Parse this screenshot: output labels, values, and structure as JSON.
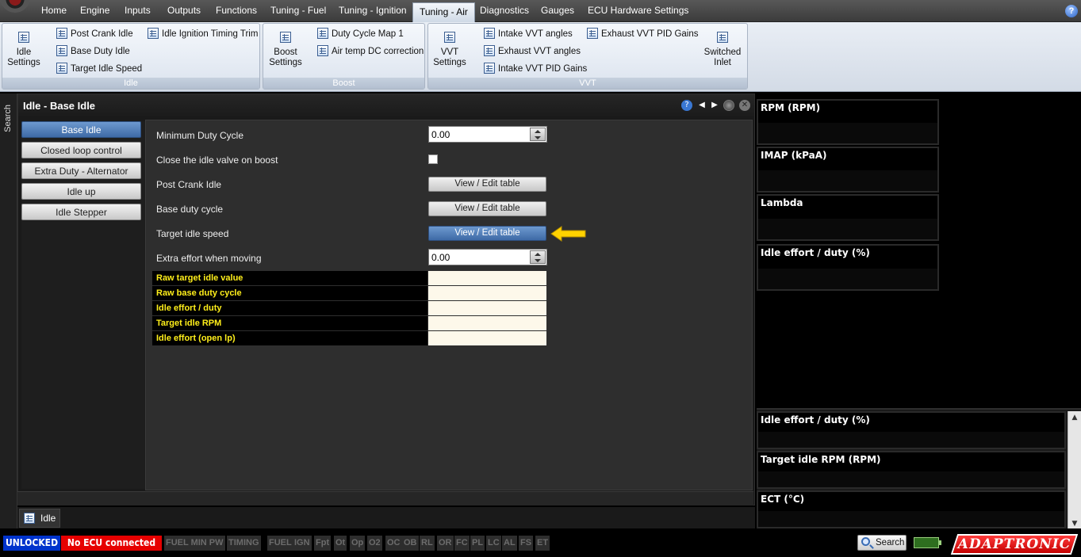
{
  "menubar": {
    "tabs": [
      "Home",
      "Engine",
      "Inputs",
      "Outputs",
      "Functions",
      "Tuning - Fuel",
      "Tuning - Ignition",
      "Tuning - Air",
      "Diagnostics",
      "Gauges",
      "ECU Hardware Settings"
    ],
    "active_tab": "Tuning - Air",
    "help_label": "?"
  },
  "ribbon": {
    "idle": {
      "title": "Idle",
      "big_button": "Idle\nSettings",
      "items": [
        "Post Crank Idle",
        "Base Duty Idle",
        "Target Idle Speed",
        "Idle Ignition Timing Trim"
      ]
    },
    "boost": {
      "title": "Boost",
      "big_button": "Boost\nSettings",
      "items": [
        "Duty Cycle Map 1",
        "Air temp DC correction"
      ]
    },
    "vvt": {
      "title": "VVT",
      "big_button": "VVT\nSettings",
      "items": [
        "Intake VVT angles",
        "Exhaust VVT angles",
        "Intake VVT PID Gains",
        "Exhaust VVT PID Gains"
      ]
    },
    "inlet": {
      "big_button": "Switched\nInlet"
    }
  },
  "search_strip_label": "Search",
  "panel": {
    "title": "Idle - Base Idle",
    "nav": [
      "Base Idle",
      "Closed loop control",
      "Extra Duty - Alternator",
      "Idle up",
      "Idle Stepper"
    ],
    "active_nav": "Base Idle",
    "rows": {
      "min_duty_label": "Minimum Duty Cycle",
      "min_duty_value": "0.00",
      "close_valve_label": "Close the idle valve on boost",
      "post_crank_label": "Post Crank Idle",
      "base_duty_label": "Base duty cycle",
      "target_idle_label": "Target idle speed",
      "extra_effort_label": "Extra effort when moving",
      "extra_effort_value": "0.00",
      "edit_button": "View / Edit table"
    },
    "outputs": [
      "Raw target idle value",
      "Raw base duty cycle",
      "Idle effort / duty",
      "Target idle RPM",
      "Idle effort (open lp)"
    ],
    "bottom_tab": "Idle"
  },
  "gauges": {
    "upper": [
      "RPM (RPM)",
      "IMAP  (kPaA)",
      "Lambda",
      "Idle effort / duty (%)"
    ],
    "lower": [
      "Idle effort / duty (%)",
      "Target idle RPM (RPM)",
      "ECT (°C)"
    ]
  },
  "statusbar": {
    "unlocked": "UNLOCKED",
    "ecu": "No ECU connected",
    "flags": [
      "FUEL MIN PW",
      "TIMING",
      "FUEL",
      "IGN",
      "Fpt",
      "Ot",
      "Op",
      "O2",
      "OC",
      "OB",
      "RL",
      "OR",
      "FC",
      "PL",
      "LC",
      "AL",
      "FS",
      "ET"
    ],
    "search": "Search",
    "brand": "ADAPTRONIC"
  },
  "colors": {
    "accent_blue": "#3e6aa6",
    "output_label": "#ffef1a",
    "unlocked_bg": "#0033cc",
    "no_ecu_bg": "#e60000",
    "arrow": "#ffd200"
  }
}
